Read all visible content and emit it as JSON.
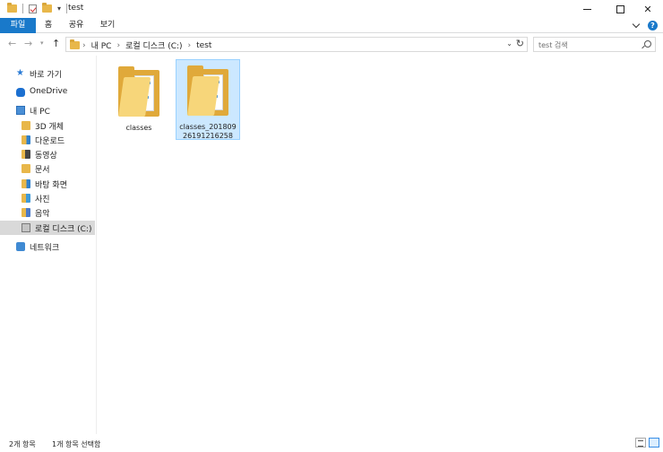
{
  "window": {
    "title": "test",
    "controls": {
      "minimize": "minimize",
      "maximize": "maximize",
      "close": "✕"
    }
  },
  "ribbon": {
    "tabs": [
      "파일",
      "홈",
      "공유",
      "보기"
    ]
  },
  "address": {
    "path": [
      "내 PC",
      "로컬 디스크 (C:)",
      "test"
    ],
    "search_placeholder": "test 검색"
  },
  "sidebar": {
    "items": [
      {
        "label": "바로 가기",
        "icon": "star-icon"
      },
      {
        "label": "OneDrive",
        "icon": "cloud-icon"
      },
      {
        "label": "내 PC",
        "icon": "pc-icon"
      },
      {
        "label": "3D 개체",
        "icon": "folder-icon"
      },
      {
        "label": "다운로드",
        "icon": "download-folder-icon"
      },
      {
        "label": "동영상",
        "icon": "video-folder-icon"
      },
      {
        "label": "문서",
        "icon": "documents-folder-icon"
      },
      {
        "label": "바탕 화면",
        "icon": "desktop-folder-icon"
      },
      {
        "label": "사진",
        "icon": "pictures-folder-icon"
      },
      {
        "label": "음악",
        "icon": "music-folder-icon"
      },
      {
        "label": "로컬 디스크 (C:)",
        "icon": "drive-icon",
        "selected": true
      },
      {
        "label": "네트워크",
        "icon": "network-icon"
      }
    ]
  },
  "files": [
    {
      "name": "classes",
      "selected": false
    },
    {
      "name": "classes_20180926191216258",
      "selected": true
    }
  ],
  "status": {
    "count": "2개 항목",
    "selection": "1개 항목 선택함"
  },
  "colors": {
    "accent": "#1979ca",
    "selection_bg": "#cce8ff",
    "folder": "#e0a93a"
  }
}
